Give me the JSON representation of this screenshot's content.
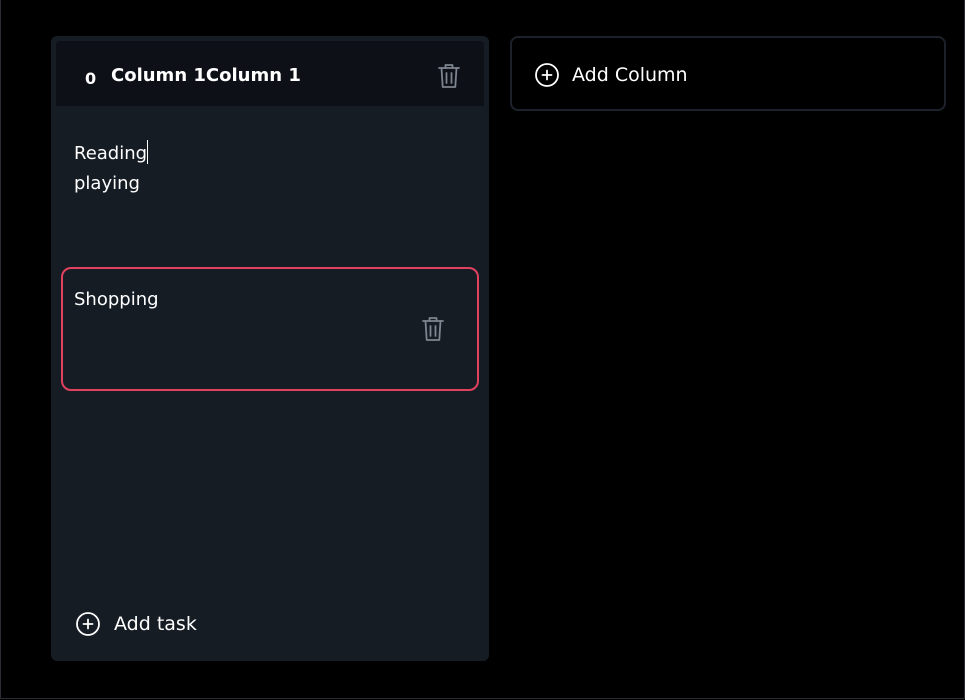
{
  "column": {
    "count": "0",
    "title": "Column 1Column 1",
    "delete_icon": "trash-icon",
    "task_editor": {
      "lines": [
        "Reading",
        "playing"
      ]
    },
    "tasks": [
      {
        "text": "Shopping",
        "delete_icon": "trash-icon"
      }
    ],
    "add_task_label": "Add task",
    "add_task_icon": "plus-circle-icon"
  },
  "add_column": {
    "label": "Add Column",
    "icon": "plus-circle-icon"
  },
  "colors": {
    "background": "#000000",
    "column_bg": "#161c24",
    "header_bg": "#0d1117",
    "selected_border": "#e0415f",
    "icon_muted": "#7d8590"
  }
}
